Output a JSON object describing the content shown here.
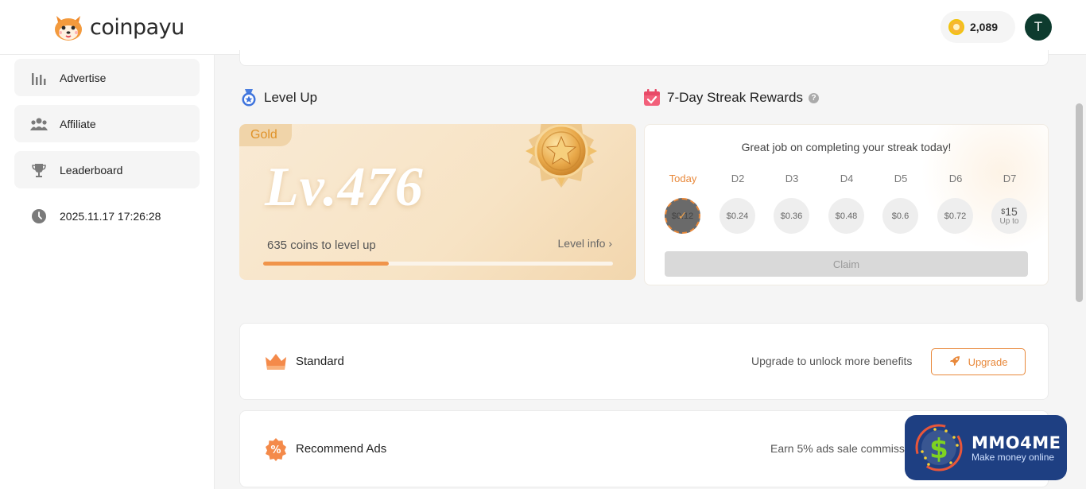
{
  "app": {
    "brand": "coinpayu"
  },
  "header": {
    "coins": "2,089",
    "avatar_initial": "T"
  },
  "sidebar": {
    "items": [
      {
        "label": "Advertise",
        "icon": "bar-chart-icon"
      },
      {
        "label": "Affiliate",
        "icon": "users-icon"
      },
      {
        "label": "Leaderboard",
        "icon": "trophy-icon"
      },
      {
        "label": "2025.11.17 17:26:28",
        "icon": "clock-icon"
      }
    ]
  },
  "level": {
    "title": "Level Up",
    "tier": "Gold",
    "level_text": "Lv.476",
    "coins_to_level": "635 coins to level up",
    "level_info": "Level info ›",
    "progress_fraction": 0.36
  },
  "streak": {
    "title": "7-Day Streak Rewards",
    "help": "?",
    "message": "Great job on completing your streak today!",
    "days": [
      {
        "label": "Today",
        "amount": "$0.12"
      },
      {
        "label": "D2",
        "amount": "$0.24"
      },
      {
        "label": "D3",
        "amount": "$0.36"
      },
      {
        "label": "D4",
        "amount": "$0.48"
      },
      {
        "label": "D5",
        "amount": "$0.6"
      },
      {
        "label": "D6",
        "amount": "$0.72"
      },
      {
        "label": "D7",
        "amount_prefix": "$",
        "amount": "15",
        "sub": "Up to"
      }
    ],
    "claim_label": "Claim"
  },
  "membership": {
    "title": "Standard",
    "note": "Upgrade to unlock more benefits",
    "button": "Upgrade"
  },
  "recommend": {
    "title": "Recommend Ads",
    "note": "Earn 5% ads sale commission"
  },
  "watermark": {
    "title": "MMO4ME",
    "subtitle": "Make money online"
  },
  "colors": {
    "accent": "#e8883a",
    "gold": "#e0932a",
    "avatar_bg": "#0d3b2e"
  }
}
